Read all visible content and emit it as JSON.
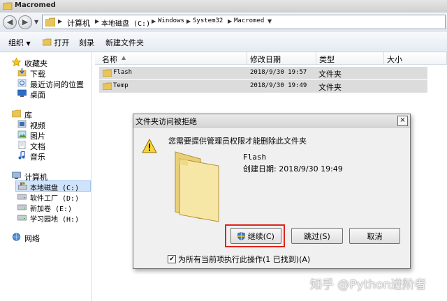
{
  "window": {
    "title": "Macromed"
  },
  "breadcrumb": [
    "计算机",
    "本地磁盘 (C:)",
    "Windows",
    "System32",
    "Macromed"
  ],
  "toolbar": {
    "organize": "组织",
    "open": "打开",
    "burn": "刻录",
    "new_folder": "新建文件夹"
  },
  "nav": {
    "favorites": "收藏夹",
    "downloads": "下载",
    "recent": "最近访问的位置",
    "desktop": "桌面",
    "libraries": "库",
    "video": "视频",
    "pictures": "图片",
    "documents": "文档",
    "music": "音乐",
    "computer": "计算机",
    "drive_c": "本地磁盘 (C:)",
    "drive_d": "软件工厂 (D:)",
    "drive_e": "新加卷 (E:)",
    "drive_h": "学习园地 (H:)",
    "network": "网络"
  },
  "columns": {
    "name": "名称",
    "modified": "修改日期",
    "type": "类型",
    "size": "大小"
  },
  "files": [
    {
      "name": "Flash",
      "modified": "2018/9/30 19:57",
      "type": "文件夹"
    },
    {
      "name": "Temp",
      "modified": "2018/9/30 19:49",
      "type": "文件夹"
    }
  ],
  "dialog": {
    "title": "文件夹访问被拒绝",
    "close": "×",
    "message": "您需要提供管理员权限才能删除此文件夹",
    "folder_name": "Flash",
    "created": "创建日期: 2018/9/30 19:49",
    "continue_label": "继续(C)",
    "skip_label": "跳过(S)",
    "cancel_label": "取消",
    "checkbox_label": "为所有当前项执行此操作(1 已找到)(A)",
    "checkbox_checked": true
  },
  "watermark": "知乎 @Python进阶者"
}
